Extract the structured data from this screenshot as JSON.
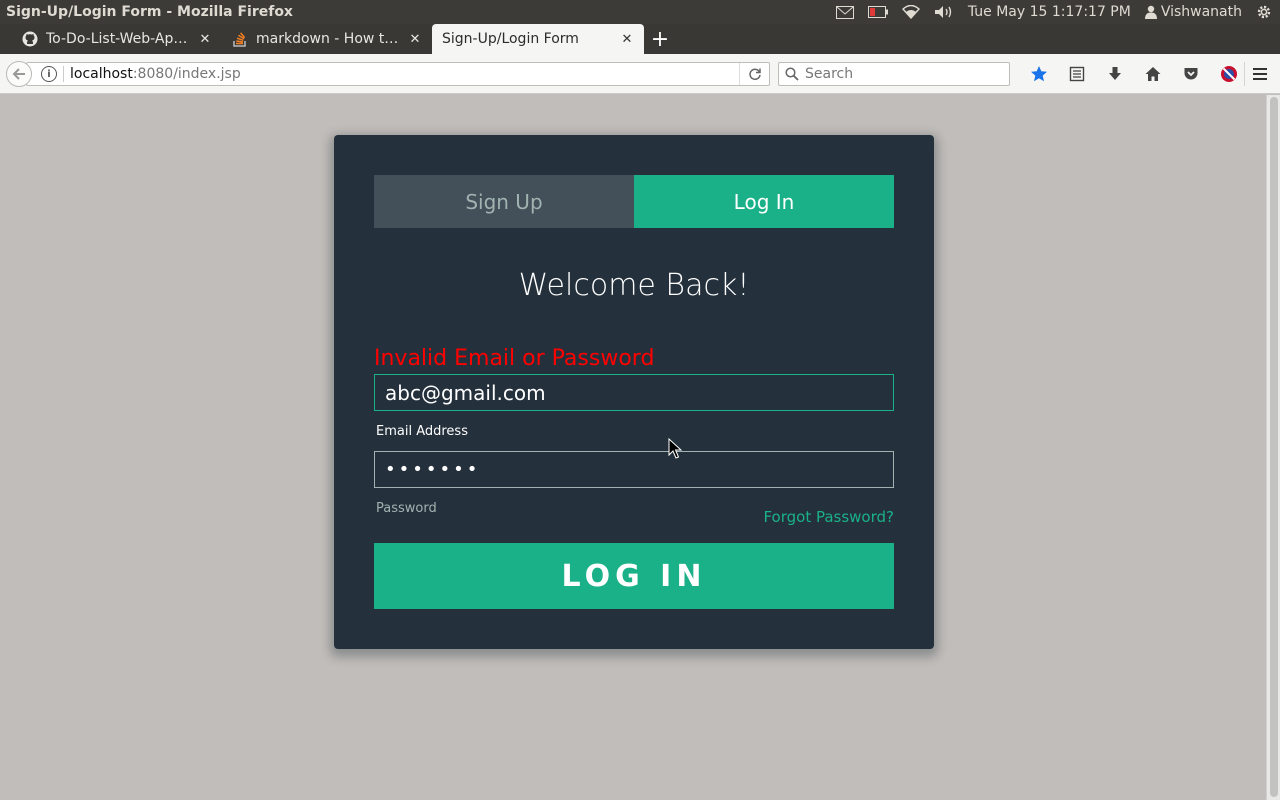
{
  "system_bar": {
    "window_title": "Sign-Up/Login Form - Mozilla Firefox",
    "datetime": "Tue May 15  1:17:17 PM",
    "user": "Vishwanath",
    "icons": [
      "mail-icon",
      "battery-icon",
      "wifi-icon",
      "volume-icon",
      "user-icon",
      "settings-gear-icon"
    ]
  },
  "browser": {
    "tabs": [
      {
        "label": "To-Do-List-Web-App…",
        "icon": "github-icon"
      },
      {
        "label": "markdown - How to …",
        "icon": "stackoverflow-icon"
      },
      {
        "label": "Sign-Up/Login Form",
        "icon": "",
        "active": true
      }
    ],
    "new_tab_label": "+",
    "url_host": "localhost",
    "url_rest": ":8080/index.jsp",
    "search_placeholder": "Search",
    "toolbar_icons": [
      "bookmark-star-icon",
      "reading-list-icon",
      "download-icon",
      "home-icon",
      "pocket-icon",
      "addon-icon",
      "menu-icon"
    ]
  },
  "form": {
    "tab_signup": "Sign Up",
    "tab_login": "Log In",
    "heading": "Welcome Back!",
    "error_message": "Invalid Email or Password",
    "email_value": "abc@gmail.com",
    "email_label": "Email Address",
    "password_value": "•••••••",
    "password_label": "Password",
    "forgot_link": "Forgot Password?",
    "submit_label": "LOG IN"
  },
  "colors": {
    "page_bg": "#c1bdba",
    "card_bg": "#24303c",
    "accent": "#1ab188",
    "inactive_tab": "#435059",
    "error": "#ff0000"
  }
}
